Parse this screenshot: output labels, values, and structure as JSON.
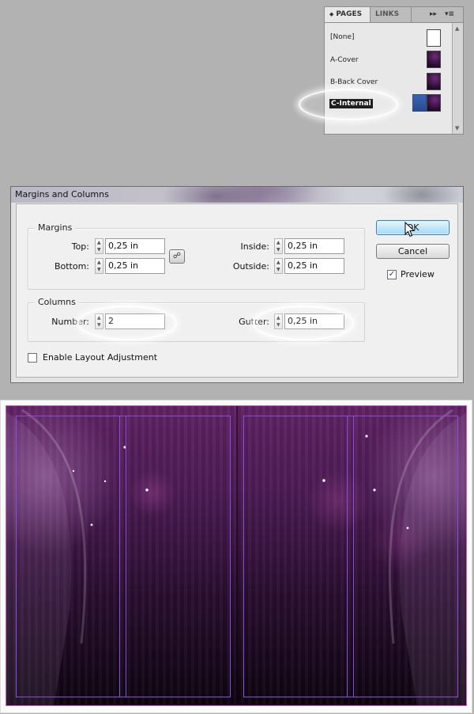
{
  "pages_panel": {
    "tabs": [
      {
        "label": "PAGES",
        "active": true
      },
      {
        "label": "LINKS",
        "active": false
      }
    ],
    "icons": {
      "forward": "double-arrow-icon",
      "menu": "panel-menu-icon"
    },
    "pages": [
      {
        "label": "[None]",
        "thumbnail": "blank"
      },
      {
        "label": "A-Cover",
        "thumbnail": "purple"
      },
      {
        "label": "B-Back Cover",
        "thumbnail": "purple"
      },
      {
        "label": "C-Internal",
        "thumbnail": "blue-purple",
        "selected": true
      }
    ]
  },
  "dialog": {
    "title": "Margins and Columns",
    "margins": {
      "group_label": "Margins",
      "top": {
        "label": "Top:",
        "value": "0,25 in"
      },
      "bottom": {
        "label": "Bottom:",
        "value": "0,25 in"
      },
      "inside": {
        "label": "Inside:",
        "value": "0,25 in"
      },
      "outside": {
        "label": "Outside:",
        "value": "0,25 in"
      }
    },
    "columns": {
      "group_label": "Columns",
      "number": {
        "label": "Number:",
        "value": "2"
      },
      "gutter": {
        "label": "Gutter:",
        "value": "0,25 in"
      }
    },
    "enable_layout_adjustment": {
      "label": "Enable Layout Adjustment",
      "checked": false
    },
    "buttons": {
      "ok": "OK",
      "cancel": "Cancel"
    },
    "preview": {
      "label": "Preview",
      "checked": true
    }
  },
  "colors": {
    "accent_purple": "#5f2263",
    "margin_guides": "#8a4fd8",
    "ok_button": "#bee6fd"
  }
}
